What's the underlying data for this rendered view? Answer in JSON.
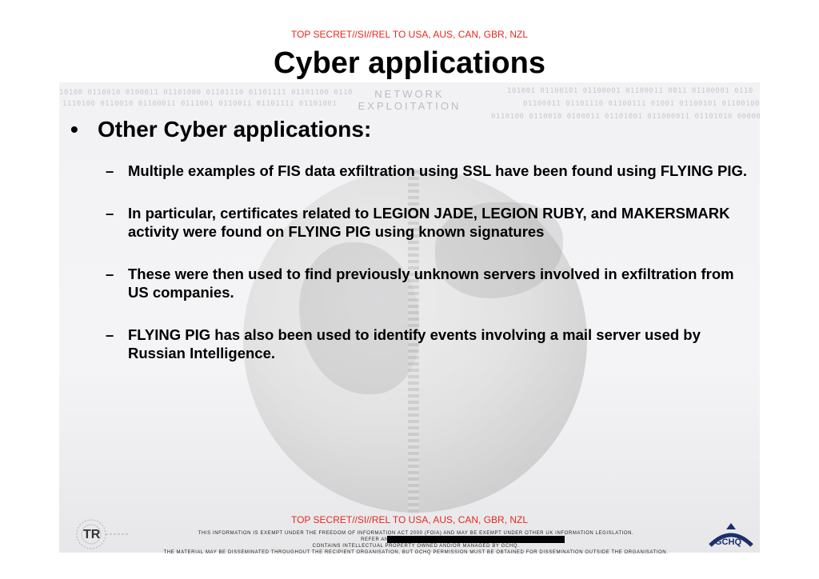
{
  "classification_top": "TOP SECRET//SI//REL TO USA, AUS, CAN, GBR, NZL",
  "title": "Cyber applications",
  "background_label": {
    "line1": "NETWORK",
    "line2": "EXPLOITATION"
  },
  "binary_strips": [
    "10100 0110010 0100011 01101000 01101110 01101111 01101100 0110",
    "1110100 0110010 01100011 0111001 0110011 01101111 01101001",
    "101001 01100101 01100001 01100011 0011 01100001 0110",
    "01100011 01101110 01100111 01001 01100101 01100100",
    "0110100 0110010 0100011 01101001 011000011 01101010 000001"
  ],
  "main_bullet": {
    "symbol": "•",
    "text": "Other Cyber applications:"
  },
  "sub_items": [
    {
      "dash": "–",
      "text": "Multiple examples of FIS data exfiltration using SSL have been found using FLYING PIG."
    },
    {
      "dash": "–",
      "text": "In particular, certificates related to LEGION JADE, LEGION RUBY, and MAKERSMARK activity were found on FLYING PIG using known signatures"
    },
    {
      "dash": "–",
      "text": "These were then used to find previously unknown servers involved in exfiltration from US companies."
    },
    {
      "dash": "–",
      "text": "FLYING PIG has also been used to identify events involving a mail server used by Russian Intelligence."
    }
  ],
  "classification_bottom": "TOP SECRET//SI//REL TO USA, AUS, CAN, GBR, NZL",
  "legal": {
    "line1": "This information is exempt under the Freedom of Information Act 2000 (FOIA) and may be exempt under other UK information legislation.",
    "line2": "Refer any FOIA queries to GCHQ on",
    "line3": "Contains Intellectual Property owned and/or managed by GCHQ.",
    "line4": "The material may be disseminated throughout the recipient organisation, but GCHQ permission must be obtained for dissemination outside the organisation."
  },
  "logos": {
    "left": "TR",
    "right": "GCHQ"
  },
  "colors": {
    "classification": "#e8271b",
    "gchq_blue": "#1c2f6b"
  }
}
